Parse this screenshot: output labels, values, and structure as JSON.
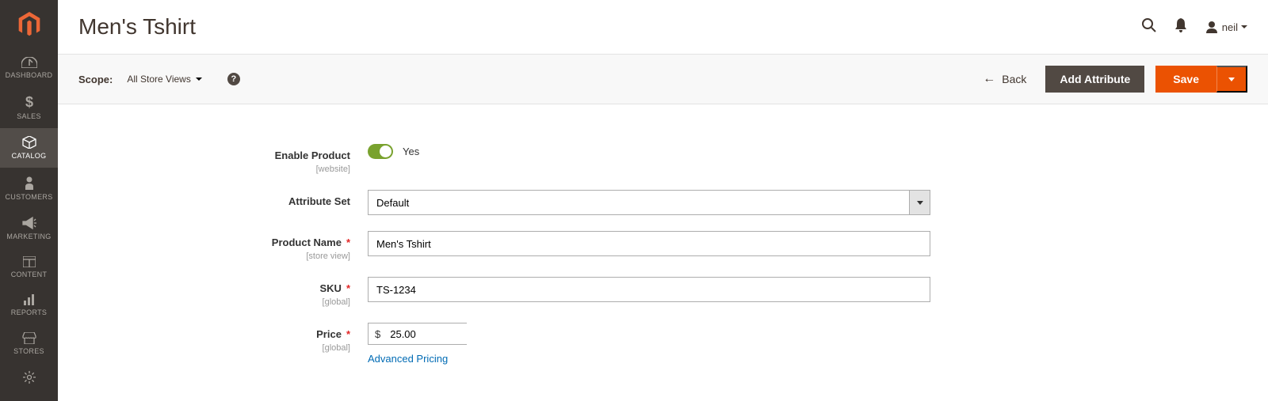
{
  "sidebar": {
    "items": [
      {
        "label": "DASHBOARD"
      },
      {
        "label": "SALES"
      },
      {
        "label": "CATALOG"
      },
      {
        "label": "CUSTOMERS"
      },
      {
        "label": "MARKETING"
      },
      {
        "label": "CONTENT"
      },
      {
        "label": "REPORTS"
      },
      {
        "label": "STORES"
      }
    ]
  },
  "header": {
    "title": "Men's Tshirt",
    "username": "neil"
  },
  "scope_bar": {
    "label": "Scope:",
    "value": "All Store Views",
    "back_label": "Back",
    "add_attribute_label": "Add Attribute",
    "save_label": "Save"
  },
  "form": {
    "enable_product": {
      "label": "Enable Product",
      "sublabel": "[website]",
      "toggle_text": "Yes"
    },
    "attribute_set": {
      "label": "Attribute Set",
      "value": "Default"
    },
    "product_name": {
      "label": "Product Name",
      "sublabel": "[store view]",
      "value": "Men's Tshirt"
    },
    "sku": {
      "label": "SKU",
      "sublabel": "[global]",
      "value": "TS-1234"
    },
    "price": {
      "label": "Price",
      "sublabel": "[global]",
      "currency": "$",
      "value": "25.00",
      "advanced_link": "Advanced Pricing"
    }
  }
}
